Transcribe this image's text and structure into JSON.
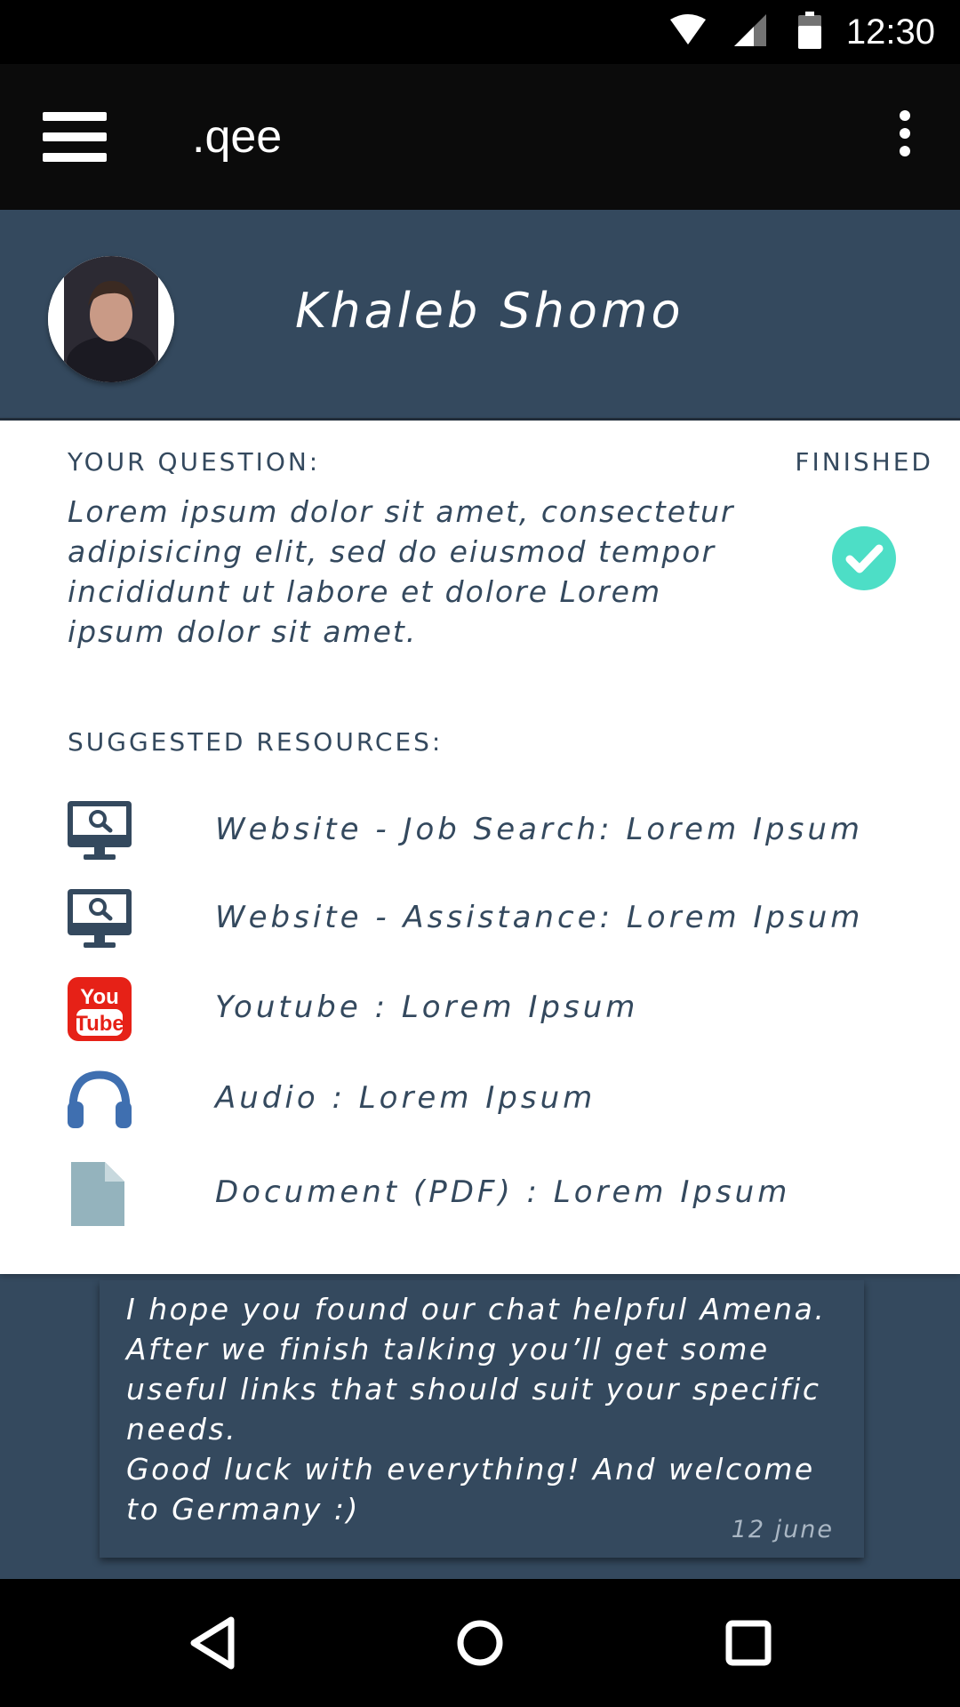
{
  "status_bar": {
    "time": "12:30",
    "icons": [
      "wifi-icon",
      "cell-signal-icon",
      "battery-icon"
    ]
  },
  "app_bar": {
    "title": ".qee",
    "menu_icon": "hamburger-menu-icon",
    "overflow_icon": "more-vert-icon"
  },
  "profile": {
    "name": "Khaleb Shomo"
  },
  "question": {
    "label": "YOUR QUESTION:",
    "status": "FINISHED",
    "text": "Lorem ipsum dolor sit amet, consectetur adipisicing elit, sed do eiusmod tempor incididunt ut labore et dolore Lorem ipsum dolor sit amet."
  },
  "resources": {
    "label": "SUGGESTED RESOURCES:",
    "items": [
      {
        "label": "Website - Job Search: Lorem Ipsum",
        "icon": "website-search-icon"
      },
      {
        "label": "Website - Assistance: Lorem Ipsum",
        "icon": "website-search-icon"
      },
      {
        "label": "Youtube : Lorem Ipsum",
        "icon": "youtube-icon"
      },
      {
        "label": "Audio : Lorem Ipsum",
        "icon": "headphones-icon"
      },
      {
        "label": "Document (PDF) : Lorem Ipsum",
        "icon": "document-icon"
      }
    ]
  },
  "message": {
    "text": "I hope you found our chat helpful Amena. After we finish talking you’ll get some useful links that should suit your specific needs.\nGood luck with everything! And welcome to Germany :)",
    "date": "12 june"
  },
  "colors": {
    "primary": "#34495e",
    "accent": "#4ddec6",
    "youtube": "#e62117",
    "audio": "#3f6fb0",
    "document": "#94b3bd"
  }
}
